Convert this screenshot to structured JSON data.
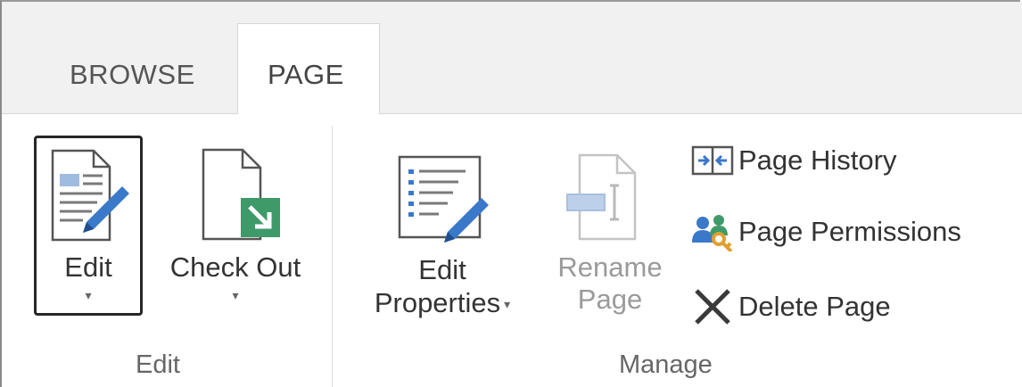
{
  "tabs": [
    {
      "label": "BROWSE",
      "selected": false
    },
    {
      "label": "PAGE",
      "selected": true
    }
  ],
  "groups": {
    "edit": {
      "label": "Edit",
      "buttons": {
        "edit": {
          "label": "Edit",
          "icon": "edit-page-icon"
        },
        "check_out": {
          "label": "Check Out",
          "icon": "check-out-icon"
        }
      }
    },
    "manage": {
      "label": "Manage",
      "buttons": {
        "edit_properties": {
          "label_line1": "Edit",
          "label_line2": "Properties",
          "icon": "edit-properties-icon"
        },
        "rename_page": {
          "label_line1": "Rename",
          "label_line2": "Page",
          "icon": "rename-page-icon",
          "disabled": true
        },
        "page_history": {
          "label": "Page History",
          "icon": "compare-icon"
        },
        "page_permissions": {
          "label": "Page Permissions",
          "icon": "users-key-icon"
        },
        "delete_page": {
          "label": "Delete Page",
          "icon": "delete-x-icon"
        }
      }
    }
  },
  "dropdown_caret": "▾",
  "colors": {
    "accent_blue": "#3a78c9",
    "checkout_green": "#3f9a6a",
    "tab_bar_bg": "#f1f1f1"
  }
}
